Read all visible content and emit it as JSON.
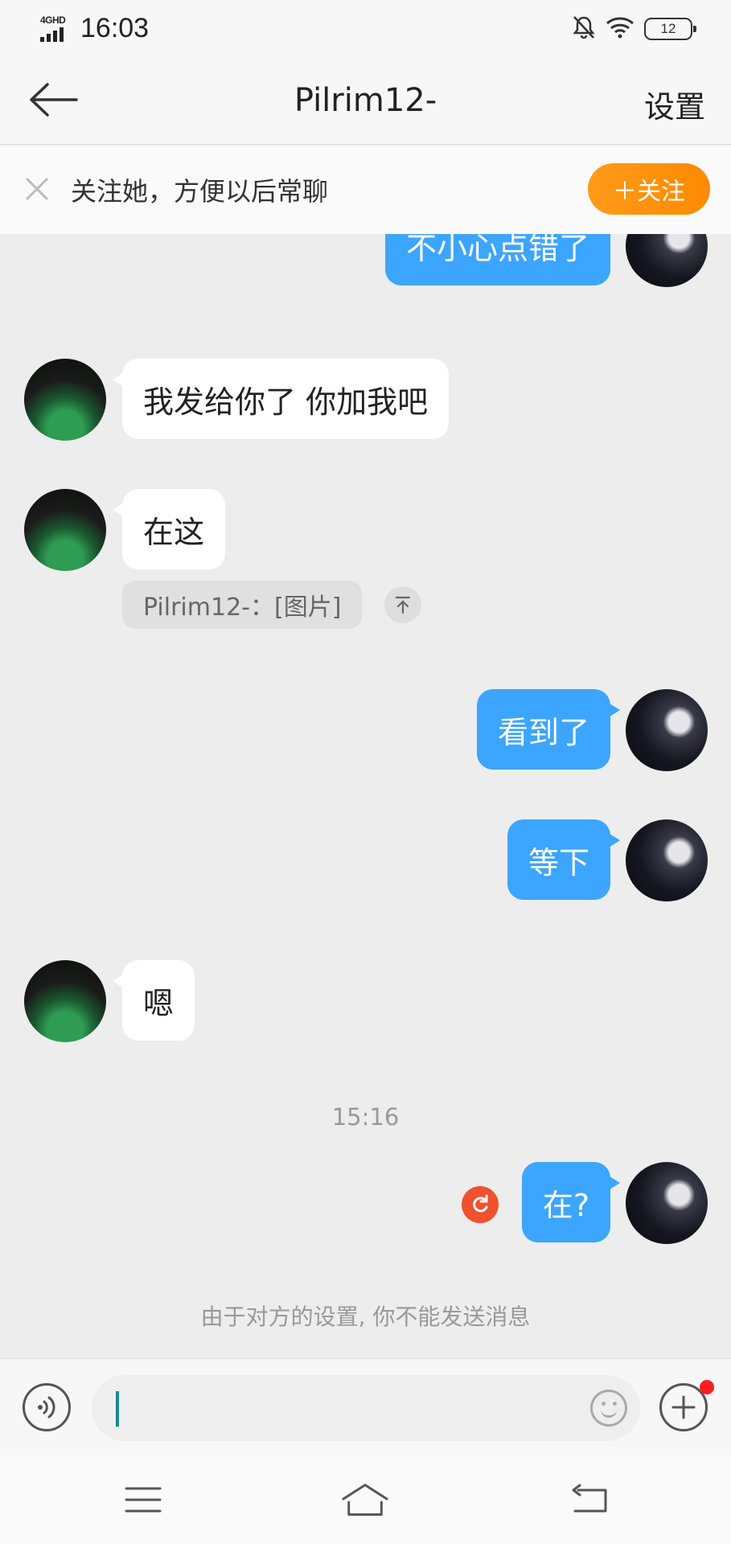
{
  "status_bar": {
    "network": "4GHD",
    "time": "16:03",
    "battery": "12",
    "icons": [
      "signal-icon",
      "bell-off-icon",
      "wifi-icon",
      "battery-icon"
    ]
  },
  "nav": {
    "title": "Pilrim12-",
    "settings_label": "设置",
    "icons": [
      "back-arrow-icon"
    ]
  },
  "banner": {
    "text": "关注她，方便以后常聊",
    "follow_label": "＋关注",
    "icons": [
      "close-icon"
    ]
  },
  "messages": [
    {
      "side": "out",
      "text": "不小心点错了"
    },
    {
      "side": "in",
      "text": "我发给你了 你加我吧"
    },
    {
      "side": "in",
      "text": "在这"
    },
    {
      "side": "out",
      "text": "看到了"
    },
    {
      "side": "out",
      "text": "等下"
    },
    {
      "side": "in",
      "text": "嗯"
    },
    {
      "side": "out",
      "text": "在?"
    }
  ],
  "reply_chip": {
    "text": "Pilrim12-：[图片]"
  },
  "timestamp": "15:16",
  "notice": "由于对方的设置, 你不能发送消息",
  "input_bar": {
    "placeholder": "",
    "icons": [
      "voice-icon",
      "emoji-icon",
      "plus-icon",
      "notification-dot"
    ]
  },
  "system_nav": {
    "icons": [
      "menu-icon",
      "home-icon",
      "back-icon"
    ]
  },
  "colors": {
    "outgoing_bubble": "#3ca5ff",
    "incoming_bubble": "#ffffff",
    "follow_button": "#ff8a00",
    "retry_icon": "#f0512e",
    "background": "#ededed"
  }
}
